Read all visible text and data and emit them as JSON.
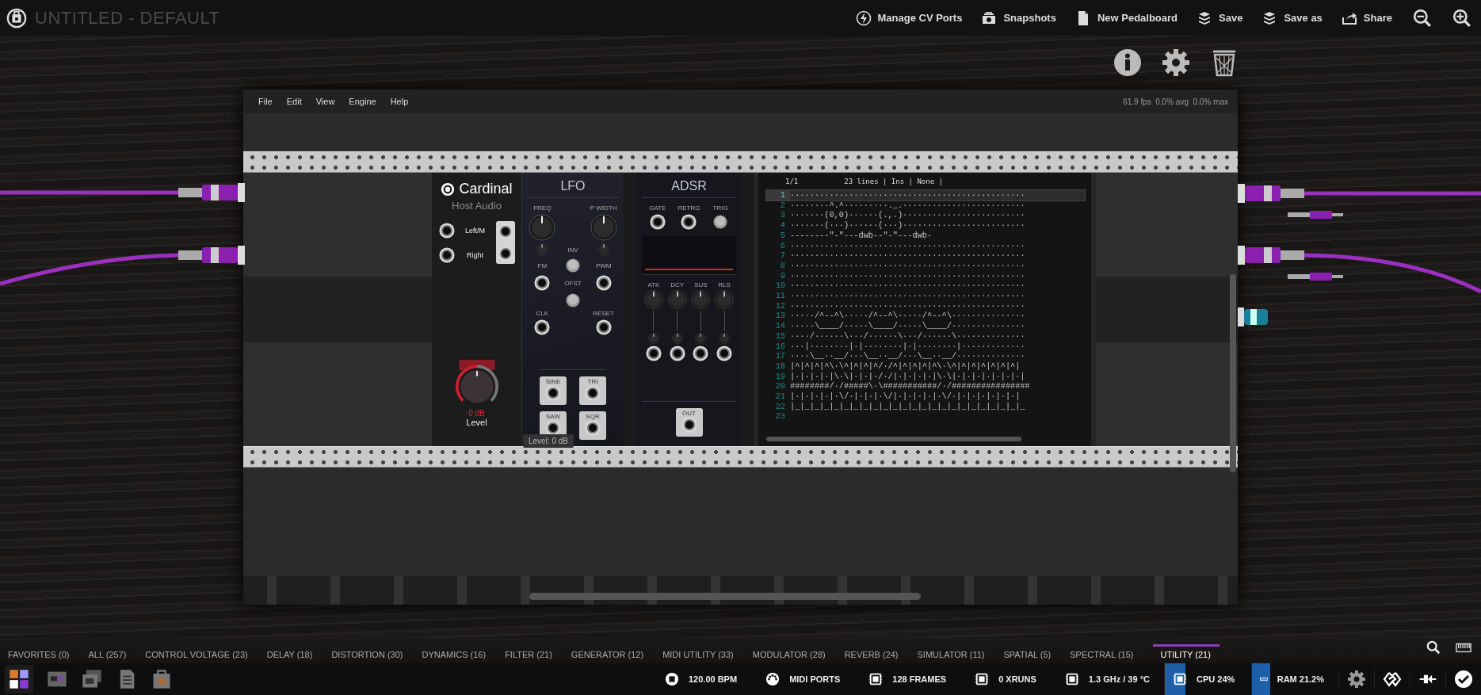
{
  "toolbar": {
    "title": "UNTITLED - DEFAULT",
    "actions": [
      {
        "kind": "cv",
        "label": "Manage CV Ports"
      },
      {
        "kind": "snapshots",
        "label": "Snapshots"
      },
      {
        "kind": "new",
        "label": "New Pedalboard"
      },
      {
        "kind": "save",
        "label": "Save"
      },
      {
        "kind": "saveas",
        "label": "Save as"
      },
      {
        "kind": "share",
        "label": "Share"
      }
    ]
  },
  "cardinal": {
    "menu": [
      "File",
      "Edit",
      "View",
      "Engine",
      "Help"
    ],
    "stats": "61.9 fps  0.0% avg  0.0% max",
    "host_audio": {
      "brand": "Cardinal",
      "title": "Host Audio",
      "ports": [
        "Left/M",
        "Right"
      ],
      "level_value": "0 dB",
      "level_label": "Level",
      "tooltip": "Level: 0 dB"
    },
    "lfo": {
      "title": "LFO",
      "labels": {
        "freq": "FREQ",
        "pwidth": "P WIDTH",
        "inv": "INV",
        "fm": "FM",
        "pwm": "PWM",
        "ofst": "OFST",
        "clk": "CLK",
        "reset": "RESET"
      },
      "outputs": [
        "SINE",
        "TRI",
        "SAW",
        "SQR"
      ]
    },
    "adsr": {
      "title": "ADSR",
      "inputs": [
        "GATE",
        "RETRG",
        "TRIG"
      ],
      "knobs": [
        "ATK",
        "DCY",
        "SUS",
        "RLS"
      ],
      "output": "OUT"
    },
    "text_editor": {
      "position": "1/1",
      "status": "23 lines | Ins | None |",
      "lines": [
        {
          "number": "1",
          "current": true,
          "text": "················································"
        },
        {
          "number": "2",
          "current": false,
          "text": "········^.^·········._.·························"
        },
        {
          "number": "3",
          "current": false,
          "text": "·······(0,0)······(.,.)·························"
        },
        {
          "number": "4",
          "current": false,
          "text": "·······(···)······(···)·························"
        },
        {
          "number": "5",
          "current": false,
          "text": "--------\"-\"---dwb--\"-\"---dwb-"
        },
        {
          "number": "6",
          "current": false,
          "text": "················································"
        },
        {
          "number": "7",
          "current": false,
          "text": "················································"
        },
        {
          "number": "8",
          "current": false,
          "text": "················································"
        },
        {
          "number": "9",
          "current": false,
          "text": "················································"
        },
        {
          "number": "10",
          "current": false,
          "text": "················································"
        },
        {
          "number": "11",
          "current": false,
          "text": "················································"
        },
        {
          "number": "12",
          "current": false,
          "text": "················································"
        },
        {
          "number": "13",
          "current": false,
          "text": "·····/^--^\\·····/^--^\\·····/^--^\\···············"
        },
        {
          "number": "14",
          "current": false,
          "text": "·····\\____/·····\\____/·····\\____/···············"
        },
        {
          "number": "15",
          "current": false,
          "text": "····/······\\···/······\\···/······\\··············"
        },
        {
          "number": "16",
          "current": false,
          "text": "···|········|·|········|·|········|·············"
        },
        {
          "number": "17",
          "current": false,
          "text": "····\\__··__/···\\__··__/···\\__··__/··············"
        },
        {
          "number": "18",
          "current": false,
          "text": "|^|^|^|^\\·\\^|^|^|^/·/^|^|^|^|^\\·\\^|^|^|^|^|^|^|"
        },
        {
          "number": "19",
          "current": false,
          "text": "|·|·|·|·|\\·\\|·|·|·/·/|·|·|·|·|\\·\\|·|·|·|·|·|·|·|"
        },
        {
          "number": "20",
          "current": false,
          "text": "########/·/#####\\·\\###########/·/################"
        },
        {
          "number": "21",
          "current": false,
          "text": "|·|·|·|·|·\\/·|·|·|·\\/|·|·|·|·|·\\/·|·|·|·|·|·|·|"
        },
        {
          "number": "22",
          "current": false,
          "text": "|_|_|_|_|_|_|_|_|_|_|_|_|_|_|_|_|_|_|_|_|_|_|_|_"
        },
        {
          "number": "23",
          "current": false
        }
      ]
    }
  },
  "categories": [
    {
      "label": "FAVORITES (0)",
      "selected": false
    },
    {
      "label": "ALL (257)",
      "selected": false
    },
    {
      "label": "CONTROL VOLTAGE (23)",
      "selected": false
    },
    {
      "label": "DELAY (18)",
      "selected": false
    },
    {
      "label": "DISTORTION (30)",
      "selected": false
    },
    {
      "label": "DYNAMICS (16)",
      "selected": false
    },
    {
      "label": "FILTER (21)",
      "selected": false
    },
    {
      "label": "GENERATOR (12)",
      "selected": false
    },
    {
      "label": "MIDI UTILITY (33)",
      "selected": false
    },
    {
      "label": "MODULATOR (28)",
      "selected": false
    },
    {
      "label": "REVERB (24)",
      "selected": false
    },
    {
      "label": "SIMULATOR (11)",
      "selected": false
    },
    {
      "label": "SPATIAL (5)",
      "selected": false
    },
    {
      "label": "SPECTRAL (15)",
      "selected": false
    },
    {
      "label": "UTILITY (21)",
      "selected": true
    }
  ],
  "status": [
    {
      "kind": "bpm",
      "label": "120.00 BPM"
    },
    {
      "kind": "midi",
      "label": "MIDI PORTS"
    },
    {
      "kind": "chip",
      "label": "128 FRAMES"
    },
    {
      "kind": "chip",
      "label": "0 XRUNS"
    },
    {
      "kind": "chip",
      "label": "1.3 GHz / 39 °C"
    },
    {
      "kind": "cpu",
      "label": "CPU 24%",
      "level": 0.24
    },
    {
      "kind": "ram",
      "label": "RAM 21.2%",
      "level": 0.212
    }
  ]
}
